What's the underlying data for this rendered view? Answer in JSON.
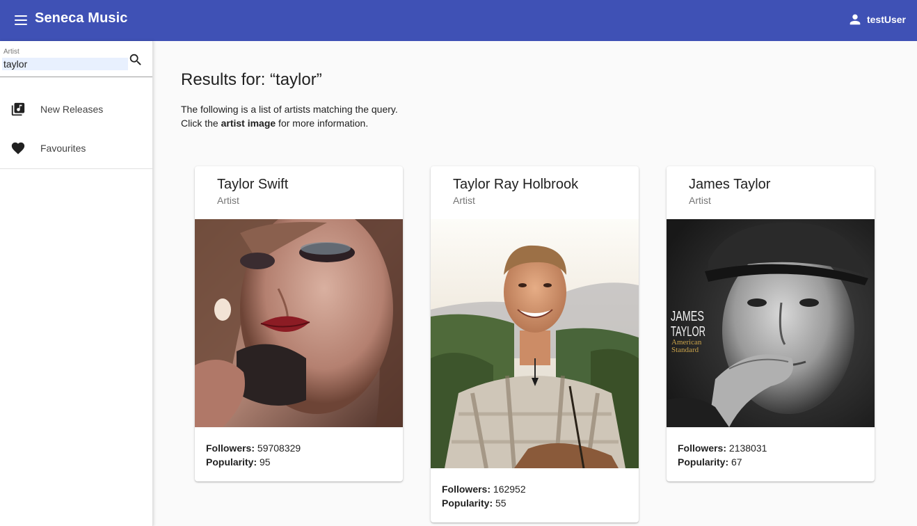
{
  "header": {
    "app_title": "Seneca Music",
    "user_name": "testUser",
    "color": "#3f51b5"
  },
  "sidebar": {
    "search": {
      "label": "Artist",
      "value": "taylor"
    },
    "items": [
      {
        "label": "New Releases",
        "icon": "library-music-icon"
      },
      {
        "label": "Favourites",
        "icon": "heart-icon"
      }
    ]
  },
  "main": {
    "title": "Results for: “taylor”",
    "description_line1": "The following is a list of artists matching the query.",
    "description_line2_pre": "Click the ",
    "description_line2_bold": "artist image",
    "description_line2_post": " for more information.",
    "followers_label": "Followers:",
    "popularity_label": "Popularity:",
    "artists": [
      {
        "name": "Taylor Swift",
        "type": "Artist",
        "followers": "59708329",
        "popularity": "95"
      },
      {
        "name": "Taylor Ray Holbrook",
        "type": "Artist",
        "followers": "162952",
        "popularity": "55"
      },
      {
        "name": "James Taylor",
        "type": "Artist",
        "followers": "2138031",
        "popularity": "67",
        "image_text_1": "JAMES",
        "image_text_2": "TAYLOR",
        "image_text_3": "American",
        "image_text_4": "Standard"
      }
    ]
  }
}
